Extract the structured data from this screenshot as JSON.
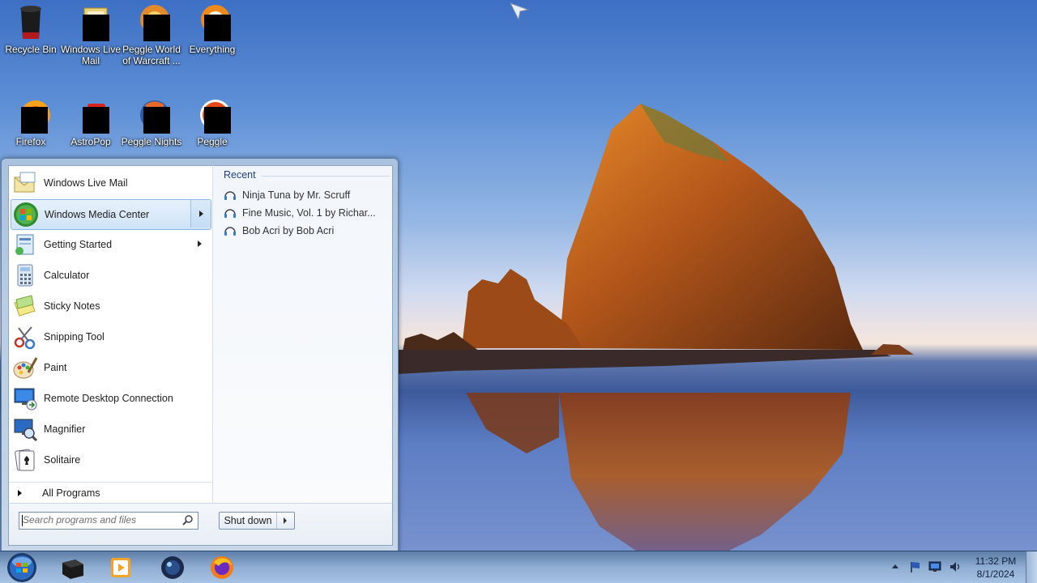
{
  "desktop": {
    "icons": [
      {
        "label": "Recycle Bin"
      },
      {
        "label": "Windows Live Mail"
      },
      {
        "label": "Peggle World of Warcraft ..."
      },
      {
        "label": "Everything"
      },
      {
        "label": "Firefox"
      },
      {
        "label": "AstroPop Deluxe"
      },
      {
        "label": "Peggle Nights"
      },
      {
        "label": "Peggle Deluxe"
      }
    ]
  },
  "start_menu": {
    "programs": [
      {
        "label": "Windows Live Mail"
      },
      {
        "label": "Windows Media Center"
      },
      {
        "label": "Getting Started"
      },
      {
        "label": "Calculator"
      },
      {
        "label": "Sticky Notes"
      },
      {
        "label": "Snipping Tool"
      },
      {
        "label": "Paint"
      },
      {
        "label": "Remote Desktop Connection"
      },
      {
        "label": "Magnifier"
      },
      {
        "label": "Solitaire"
      }
    ],
    "all_programs": "All Programs",
    "recent": {
      "header": "Recent",
      "items": [
        {
          "label": "Ninja Tuna by Mr. Scruff"
        },
        {
          "label": "Fine Music, Vol. 1 by Richar..."
        },
        {
          "label": "Bob Acri by Bob Acri"
        }
      ]
    },
    "search": {
      "placeholder": "Search programs and files",
      "value": ""
    },
    "shutdown_label": "Shut down"
  },
  "taskbar": {
    "clock": {
      "time": "11:32 PM",
      "date": "8/1/2024"
    }
  },
  "colors": {
    "start_menu_frame": "#b9cde4",
    "selection": "#cfe3f7",
    "recent_header": "#1f3e84",
    "taskbar": "#90aed3"
  }
}
